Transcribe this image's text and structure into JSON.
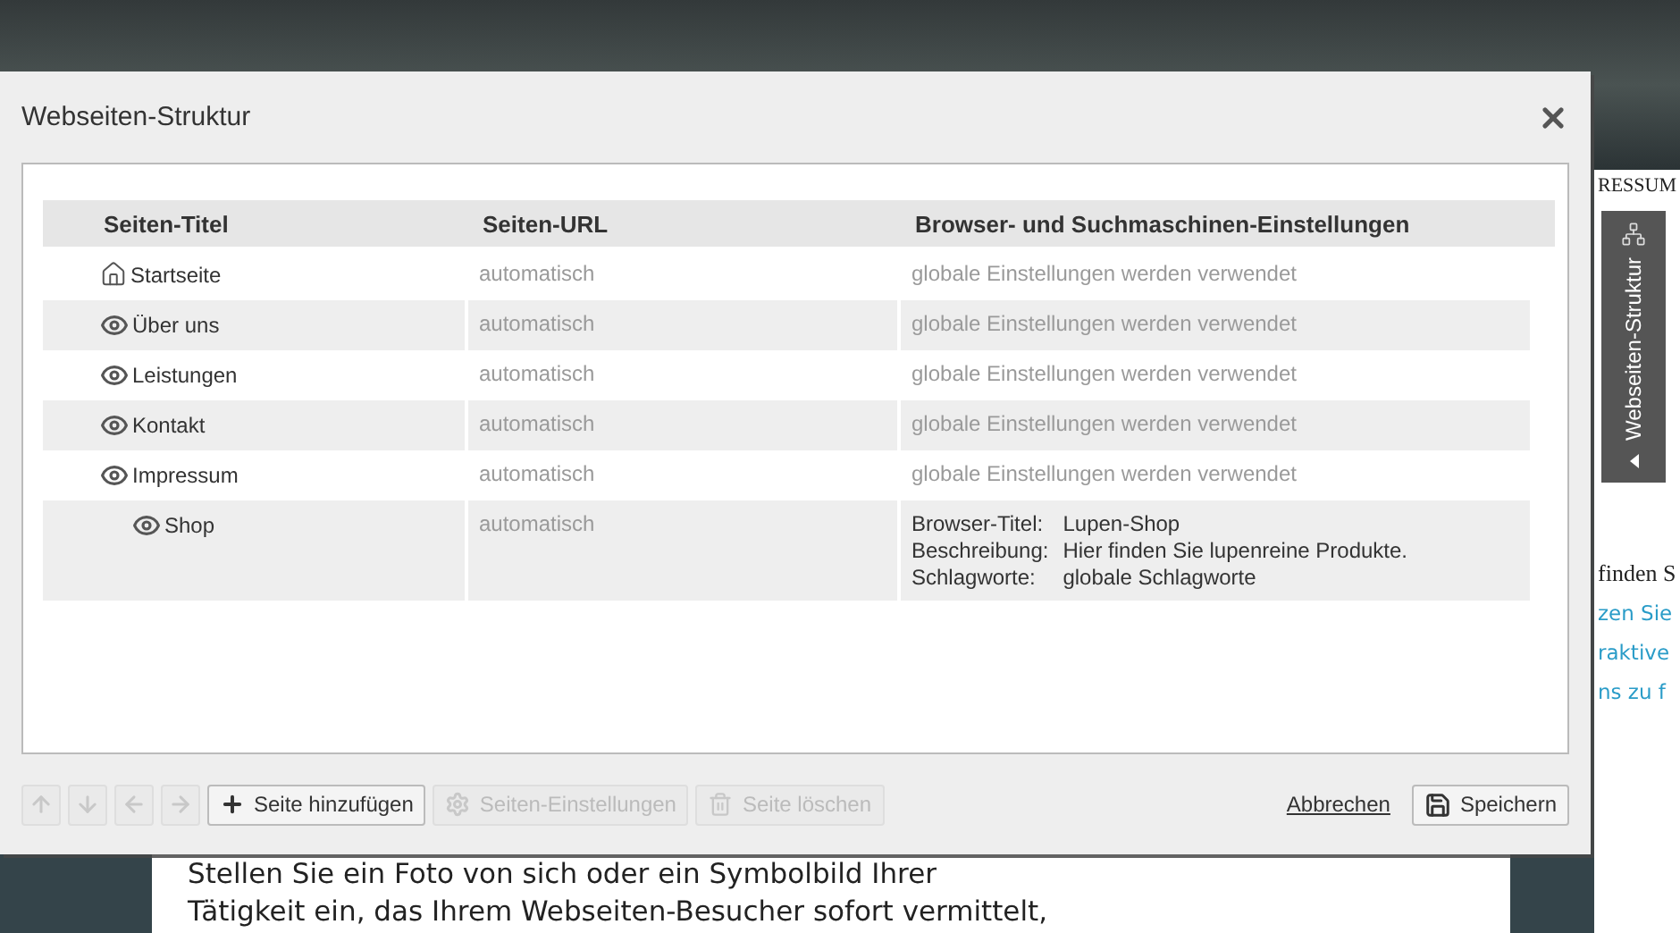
{
  "background": {
    "heading_fragment": "RESSUM",
    "side_texts": [
      {
        "text": "finden S",
        "kind": "plain"
      },
      {
        "text": "zen Sie",
        "kind": "link"
      },
      {
        "text": "raktive",
        "kind": "link"
      },
      {
        "text": "ns zu f",
        "kind": "link"
      }
    ],
    "paragraph_lines": [
      "Stellen Sie ein Foto von sich oder ein Symbolbild Ihrer",
      "Tätigkeit ein, das Ihrem Webseiten-Besucher sofort vermittelt,"
    ]
  },
  "side_tab": {
    "label": "Webseiten-Struktur"
  },
  "dialog": {
    "title": "Webseiten-Struktur",
    "table": {
      "columns": [
        "Seiten-Titel",
        "Seiten-URL",
        "Browser- und Suchmaschinen-Einstellungen"
      ],
      "rows": [
        {
          "title": "Startseite",
          "kind": "home",
          "url": "automatisch",
          "settings": {
            "kind": "global",
            "text": "globale Einstellungen werden verwendet"
          }
        },
        {
          "title": "Über uns",
          "kind": "page",
          "url": "automatisch",
          "settings": {
            "kind": "global",
            "text": "globale Einstellungen werden verwendet"
          }
        },
        {
          "title": "Leistungen",
          "kind": "page",
          "url": "automatisch",
          "settings": {
            "kind": "global",
            "text": "globale Einstellungen werden verwendet"
          }
        },
        {
          "title": "Kontakt",
          "kind": "page",
          "url": "automatisch",
          "settings": {
            "kind": "global",
            "text": "globale Einstellungen werden verwendet"
          }
        },
        {
          "title": "Impressum",
          "kind": "page",
          "url": "automatisch",
          "settings": {
            "kind": "global",
            "text": "globale Einstellungen werden verwendet"
          },
          "children": [
            {
              "title": "Shop",
              "kind": "page",
              "url": "automatisch",
              "settings": {
                "kind": "custom",
                "fields": [
                  {
                    "label": "Browser-Titel:",
                    "value": "Lupen-Shop"
                  },
                  {
                    "label": "Beschreibung:",
                    "value": "Hier finden Sie lupenreine Produkte."
                  },
                  {
                    "label": "Schlagworte:",
                    "value": "globale Schlagworte"
                  }
                ]
              }
            }
          ]
        }
      ]
    },
    "toolbar": [
      {
        "kind": "up",
        "disabled": true
      },
      {
        "kind": "down",
        "disabled": true
      },
      {
        "kind": "left",
        "disabled": true
      },
      {
        "kind": "right",
        "disabled": true
      },
      {
        "kind": "add",
        "label": "Seite hinzufügen",
        "disabled": false
      },
      {
        "kind": "settings",
        "label": "Seiten-Einstellungen",
        "disabled": true
      },
      {
        "kind": "delete",
        "label": "Seite löschen",
        "disabled": true
      }
    ],
    "cancel": "Abbrechen",
    "save": "Speichern"
  }
}
